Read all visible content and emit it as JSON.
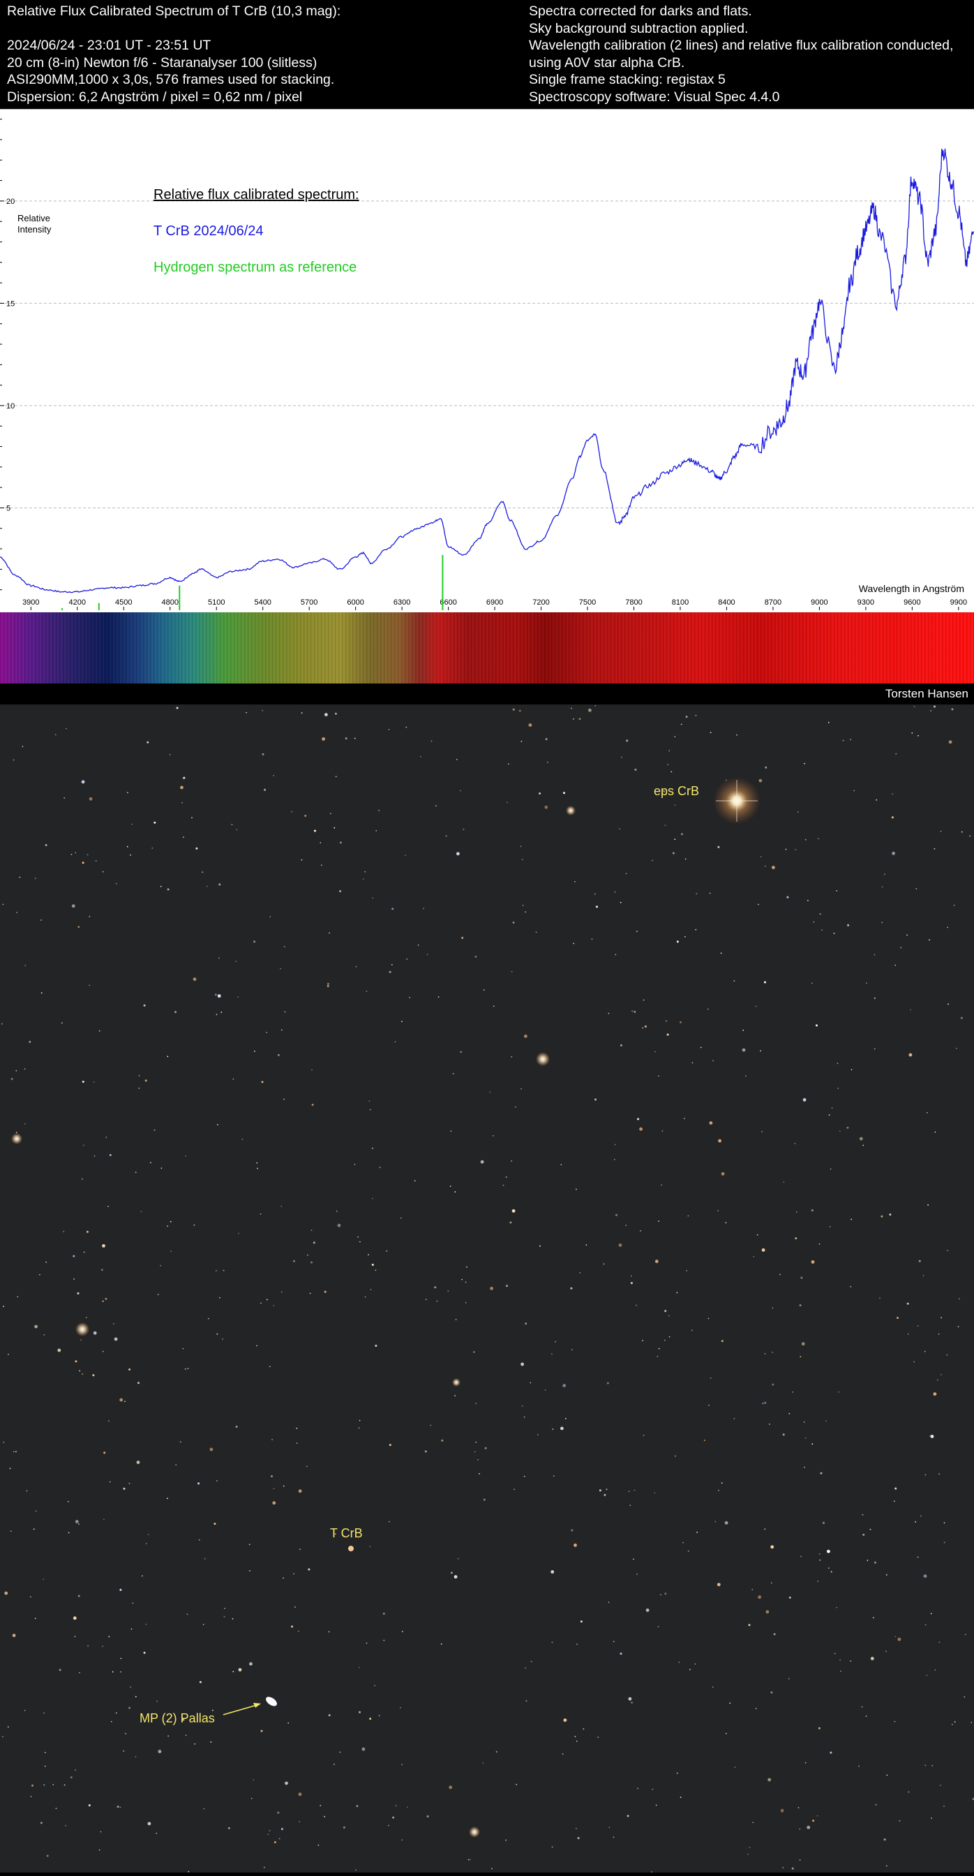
{
  "header": {
    "left_lines": [
      "Relative Flux Calibrated Spectrum of T CrB (10,3 mag):",
      "",
      "2024/06/24 - 23:01 UT - 23:51 UT",
      "20 cm (8-in) Newton f/6 - Staranalyser 100 (slitless)",
      "ASI290MM,1000 x 3,0s, 576 frames used for stacking.",
      "Dispersion: 6,2 Angström / pixel = 0,62 nm / pixel"
    ],
    "right_lines": [
      "Spectra corrected for darks and flats.",
      "Sky background subtraction applied.",
      "Wavelength calibration (2 lines) and relative flux calibration conducted,",
      "using A0V star alpha CrB.",
      "Single frame stacking: registax 5",
      "Spectroscopy software: Visual Spec 4.4.0"
    ]
  },
  "chart_data": {
    "type": "line",
    "legend": [
      {
        "text": "Relative flux calibrated spectrum:",
        "color": "#000000",
        "underline": true
      },
      {
        "text": "T CrB 2024/06/24",
        "color": "#1a1ae0"
      },
      {
        "text": "Hydrogen spectrum as reference",
        "color": "#22cc22"
      }
    ],
    "ylabel": [
      "Relative",
      "Intensity"
    ],
    "xlabel": "Wavelength in Angström",
    "xlim": [
      3700,
      10000
    ],
    "ylim": [
      0,
      24.5
    ],
    "x_ticks": [
      3900,
      4200,
      4500,
      4800,
      5100,
      5400,
      5700,
      6000,
      6300,
      6600,
      6900,
      7200,
      7500,
      7800,
      8100,
      8400,
      8700,
      9000,
      9300,
      9600,
      9900
    ],
    "y_ticks": [
      5,
      10,
      15,
      20
    ],
    "grid": "horizontal dashed",
    "series": [
      {
        "name": "T CrB 2024/06/24",
        "color": "#1a1ae0",
        "x": [
          3700,
          3800,
          3900,
          4000,
          4100,
          4200,
          4300,
          4400,
          4500,
          4600,
          4700,
          4800,
          4860,
          4950,
          5000,
          5100,
          5200,
          5300,
          5400,
          5500,
          5600,
          5700,
          5800,
          5900,
          6000,
          6050,
          6100,
          6200,
          6300,
          6400,
          6500,
          6550,
          6600,
          6700,
          6800,
          6850,
          6950,
          7000,
          7100,
          7200,
          7300,
          7400,
          7450,
          7500,
          7550,
          7600,
          7700,
          7750,
          7800,
          7900,
          8000,
          8100,
          8150,
          8200,
          8300,
          8350,
          8400,
          8450,
          8500,
          8600,
          8700,
          8750,
          8800,
          8850,
          8900,
          8950,
          9000,
          9100,
          9150,
          9200,
          9250,
          9300,
          9350,
          9400,
          9500,
          9550,
          9600,
          9650,
          9700,
          9750,
          9800,
          9850,
          9900,
          9950,
          10000
        ],
        "y": [
          2.6,
          1.7,
          1.2,
          1.0,
          0.9,
          0.9,
          1.0,
          1.1,
          1.1,
          1.2,
          1.3,
          1.6,
          1.4,
          1.8,
          2.0,
          1.6,
          1.9,
          2.0,
          2.4,
          2.5,
          2.1,
          2.3,
          2.5,
          2.0,
          2.6,
          2.8,
          2.3,
          3.0,
          3.6,
          4.0,
          4.3,
          4.5,
          3.1,
          2.7,
          3.5,
          4.2,
          5.3,
          4.4,
          3.0,
          3.4,
          4.6,
          6.4,
          7.5,
          8.3,
          8.6,
          6.9,
          4.2,
          4.7,
          5.5,
          6.1,
          6.7,
          7.1,
          7.4,
          7.2,
          6.8,
          6.4,
          6.8,
          7.5,
          8.1,
          8.0,
          8.8,
          9.2,
          10.0,
          12.0,
          11.5,
          13.5,
          15.0,
          11.8,
          13.5,
          16.0,
          17.5,
          18.6,
          19.6,
          18.2,
          15.0,
          17.0,
          21.1,
          20.0,
          17.0,
          18.5,
          22.5,
          21.0,
          19.5,
          17.0,
          18.5
        ]
      }
    ],
    "reference_lines": {
      "name": "Hydrogen spectrum as reference",
      "color": "#22cc22",
      "x": [
        4102,
        4340,
        4861,
        6563
      ],
      "height": [
        0.1,
        0.35,
        1.2,
        2.7
      ]
    }
  },
  "credit": "Torsten Hansen",
  "starfield": {
    "labels": {
      "eps_crb": "eps CrB",
      "t_crb": "T CrB",
      "pallas": "MP (2) Pallas"
    }
  }
}
